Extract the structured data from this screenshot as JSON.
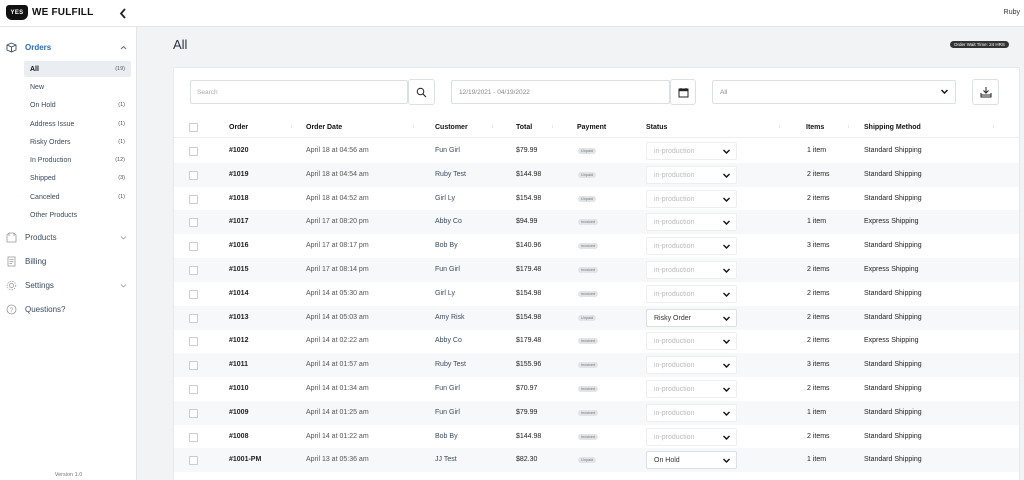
{
  "app": {
    "logo_badge": "YES",
    "logo_text": "WE FULFILL",
    "user_name": "Ruby",
    "version": "Version 1.0"
  },
  "sidebar": {
    "orders_label": "Orders",
    "sub_items": [
      {
        "label": "All",
        "count": "(19)",
        "active": true
      },
      {
        "label": "New",
        "count": ""
      },
      {
        "label": "On Hold",
        "count": "(1)"
      },
      {
        "label": "Address Issue",
        "count": "(1)"
      },
      {
        "label": "Risky Orders",
        "count": "(1)"
      },
      {
        "label": "In Production",
        "count": "(12)"
      },
      {
        "label": "Shipped",
        "count": "(3)"
      },
      {
        "label": "Canceled",
        "count": "(1)"
      },
      {
        "label": "Other Products",
        "count": ""
      }
    ],
    "products_label": "Products",
    "billing_label": "Billing",
    "settings_label": "Settings",
    "questions_label": "Questions?"
  },
  "main": {
    "title": "All",
    "wait_badge": "Order Wait Time: 24 HRS",
    "search_placeholder": "Search",
    "date_range": "12/19/2021 - 04/19/2022",
    "filter_value": "All"
  },
  "table": {
    "headers": {
      "order": "Order",
      "order_date": "Order Date",
      "customer": "Customer",
      "total": "Total",
      "payment": "Payment",
      "status": "Status",
      "items": "Items",
      "shipping": "Shipping Method"
    },
    "rows": [
      {
        "order": "#1020",
        "date": "April 18 at 04:56 am",
        "customer": "Fun Girl",
        "total": "$79.99",
        "payment": "Unpaid",
        "status": "in-production",
        "status_active": false,
        "items": "1 item",
        "shipping": "Standard Shipping"
      },
      {
        "order": "#1019",
        "date": "April 18 at 04:54 am",
        "customer": "Ruby Test",
        "total": "$144.98",
        "payment": "Unpaid",
        "status": "in-production",
        "status_active": false,
        "items": "2 items",
        "shipping": "Standard Shipping"
      },
      {
        "order": "#1018",
        "date": "April 18 at 04:52 am",
        "customer": "Girl Ly",
        "total": "$154.98",
        "payment": "Unpaid",
        "status": "in-production",
        "status_active": false,
        "items": "2 items",
        "shipping": "Standard Shipping"
      },
      {
        "order": "#1017",
        "date": "April 17 at 08:20 pm",
        "customer": "Abby Co",
        "total": "$94.99",
        "payment": "Invoiced",
        "status": "in-production",
        "status_active": false,
        "items": "1 item",
        "shipping": "Express Shipping"
      },
      {
        "order": "#1016",
        "date": "April 17 at 08:17 pm",
        "customer": "Bob By",
        "total": "$140.96",
        "payment": "Invoiced",
        "status": "in-production",
        "status_active": false,
        "items": "3 items",
        "shipping": "Standard Shipping"
      },
      {
        "order": "#1015",
        "date": "April 17 at 08:14 pm",
        "customer": "Fun Girl",
        "total": "$179.48",
        "payment": "Invoiced",
        "status": "in-production",
        "status_active": false,
        "items": "2 items",
        "shipping": "Express Shipping"
      },
      {
        "order": "#1014",
        "date": "April 14 at 05:30 am",
        "customer": "Girl Ly",
        "total": "$154.98",
        "payment": "Invoiced",
        "status": "in-production",
        "status_active": false,
        "items": "2 items",
        "shipping": "Standard Shipping"
      },
      {
        "order": "#1013",
        "date": "April 14 at 05:03 am",
        "customer": "Amy Risk",
        "total": "$154.98",
        "payment": "Unpaid",
        "status": "Risky Order",
        "status_active": true,
        "items": "2 items",
        "shipping": "Standard Shipping"
      },
      {
        "order": "#1012",
        "date": "April 14 at 02:22 am",
        "customer": "Abby Co",
        "total": "$179.48",
        "payment": "Invoiced",
        "status": "in-production",
        "status_active": false,
        "items": "2 items",
        "shipping": "Express Shipping"
      },
      {
        "order": "#1011",
        "date": "April 14 at 01:57 am",
        "customer": "Ruby Test",
        "total": "$155.96",
        "payment": "Invoiced",
        "status": "in-production",
        "status_active": false,
        "items": "3 items",
        "shipping": "Standard Shipping"
      },
      {
        "order": "#1010",
        "date": "April 14 at 01:34 am",
        "customer": "Fun Girl",
        "total": "$70.97",
        "payment": "Invoiced",
        "status": "in-production",
        "status_active": false,
        "items": "2 items",
        "shipping": "Standard Shipping"
      },
      {
        "order": "#1009",
        "date": "April 14 at 01:25 am",
        "customer": "Fun Girl",
        "total": "$79.99",
        "payment": "Invoiced",
        "status": "in-production",
        "status_active": false,
        "items": "1 item",
        "shipping": "Standard Shipping"
      },
      {
        "order": "#1008",
        "date": "April 14 at 01:22 am",
        "customer": "Bob By",
        "total": "$144.98",
        "payment": "Invoiced",
        "status": "in-production",
        "status_active": false,
        "items": "2 items",
        "shipping": "Standard Shipping"
      },
      {
        "order": "#1001-PM",
        "date": "April 13 at 05:36 am",
        "customer": "JJ Test",
        "total": "$82.30",
        "payment": "Unpaid",
        "status": "On Hold",
        "status_active": true,
        "items": "1 item",
        "shipping": "Standard Shipping"
      }
    ]
  }
}
